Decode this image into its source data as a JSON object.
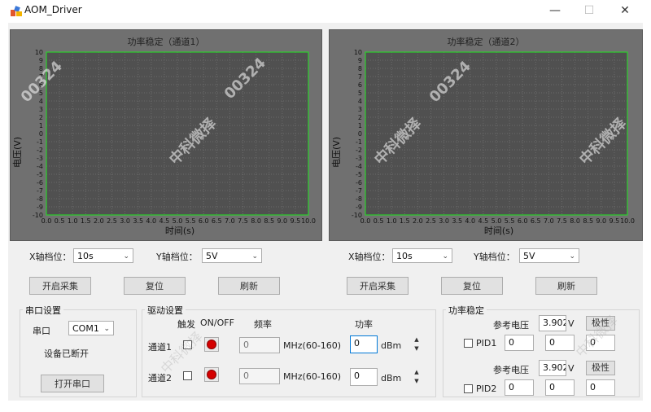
{
  "window": {
    "title": "AOM_Driver",
    "minimize": "—",
    "maximize": "☐",
    "close": "✕"
  },
  "charts": [
    {
      "title": "功率稳定（通道1）",
      "xlabel": "时间(s)",
      "ylabel": "电压(V)"
    },
    {
      "title": "功率稳定（通道2）",
      "xlabel": "时间(s)",
      "ylabel": "电压(V)"
    }
  ],
  "chart_data": [
    {
      "type": "line",
      "title": "功率稳定（通道1）",
      "xlabel": "时间(s)",
      "ylabel": "电压(V)",
      "xlim": [
        0,
        10
      ],
      "ylim": [
        -10,
        10
      ],
      "x_ticks": [
        "0.0",
        "0.5",
        "1.0",
        "1.5",
        "2.0",
        "2.5",
        "3.0",
        "3.5",
        "4.0",
        "4.5",
        "5.0",
        "5.5",
        "6.0",
        "6.5",
        "7.0",
        "7.5",
        "8.0",
        "8.5",
        "9.0",
        "9.5",
        "10.0"
      ],
      "y_ticks": [
        "10",
        "9",
        "8",
        "7",
        "6",
        "5",
        "4",
        "3",
        "2",
        "1",
        "0",
        "-1",
        "-2",
        "-3",
        "-4",
        "-5",
        "-6",
        "-7",
        "-8",
        "-9",
        "-10"
      ],
      "grid": true,
      "series": []
    },
    {
      "type": "line",
      "title": "功率稳定（通道2）",
      "xlabel": "时间(s)",
      "ylabel": "电压(V)",
      "xlim": [
        0,
        10
      ],
      "ylim": [
        -10,
        10
      ],
      "x_ticks": [
        "0.0",
        "0.5",
        "1.0",
        "1.5",
        "2.0",
        "2.5",
        "3.0",
        "3.5",
        "4.0",
        "4.5",
        "5.0",
        "5.5",
        "6.0",
        "6.5",
        "7.0",
        "7.5",
        "8.0",
        "8.5",
        "9.0",
        "9.5",
        "10.0"
      ],
      "y_ticks": [
        "10",
        "9",
        "8",
        "7",
        "6",
        "5",
        "4",
        "3",
        "2",
        "1",
        "0",
        "-1",
        "-2",
        "-3",
        "-4",
        "-5",
        "-6",
        "-7",
        "-8",
        "-9",
        "-10"
      ],
      "grid": true,
      "series": []
    }
  ],
  "axis_controls": [
    {
      "x_label": "X轴档位：",
      "x_value": "10s",
      "y_label": "Y轴档位：",
      "y_value": "5V",
      "start_btn": "开启采集",
      "reset_btn": "复位",
      "refresh_btn": "刷新"
    },
    {
      "x_label": "X轴档位：",
      "x_value": "10s",
      "y_label": "Y轴档位：",
      "y_value": "5V",
      "start_btn": "开启采集",
      "reset_btn": "复位",
      "refresh_btn": "刷新"
    }
  ],
  "serial": {
    "group_title": "串口设置",
    "port_label": "串口",
    "port_value": "COM1",
    "status": "设备已断开",
    "open_btn": "打开串口"
  },
  "drive": {
    "group_title": "驱动设置",
    "trigger_header": "触发",
    "onoff_header": "ON/OFF",
    "freq_header": "频率",
    "power_header": "功率",
    "channels": [
      {
        "label": "通道1",
        "freq": "0",
        "freq_unit": "MHz(60-160)",
        "power": "0",
        "power_unit": "dBm"
      },
      {
        "label": "通道2",
        "freq": "0",
        "freq_unit": "MHz(60-160)",
        "power": "0",
        "power_unit": "dBm"
      }
    ],
    "spin_up": "▲",
    "spin_down": "▼"
  },
  "power_stab": {
    "group_title": "功率稳定",
    "rows": [
      {
        "ref_label": "参考电压",
        "ref_value": "3.9024",
        "unit": "V",
        "polarity_btn": "极性",
        "pid_label": "PID1",
        "p": "0",
        "i": "0",
        "d": "0"
      },
      {
        "ref_label": "参考电压",
        "ref_value": "3.9024",
        "unit": "V",
        "polarity_btn": "极性",
        "pid_label": "PID2",
        "p": "0",
        "i": "0",
        "d": "0"
      }
    ]
  },
  "watermark": {
    "text_a": "00324",
    "text_b": "中科微择"
  },
  "colors": {
    "plot_bg": "#505050",
    "grid": "#6a6a6a",
    "plot_border": "#2bd02b",
    "led_off": "#d40000"
  }
}
